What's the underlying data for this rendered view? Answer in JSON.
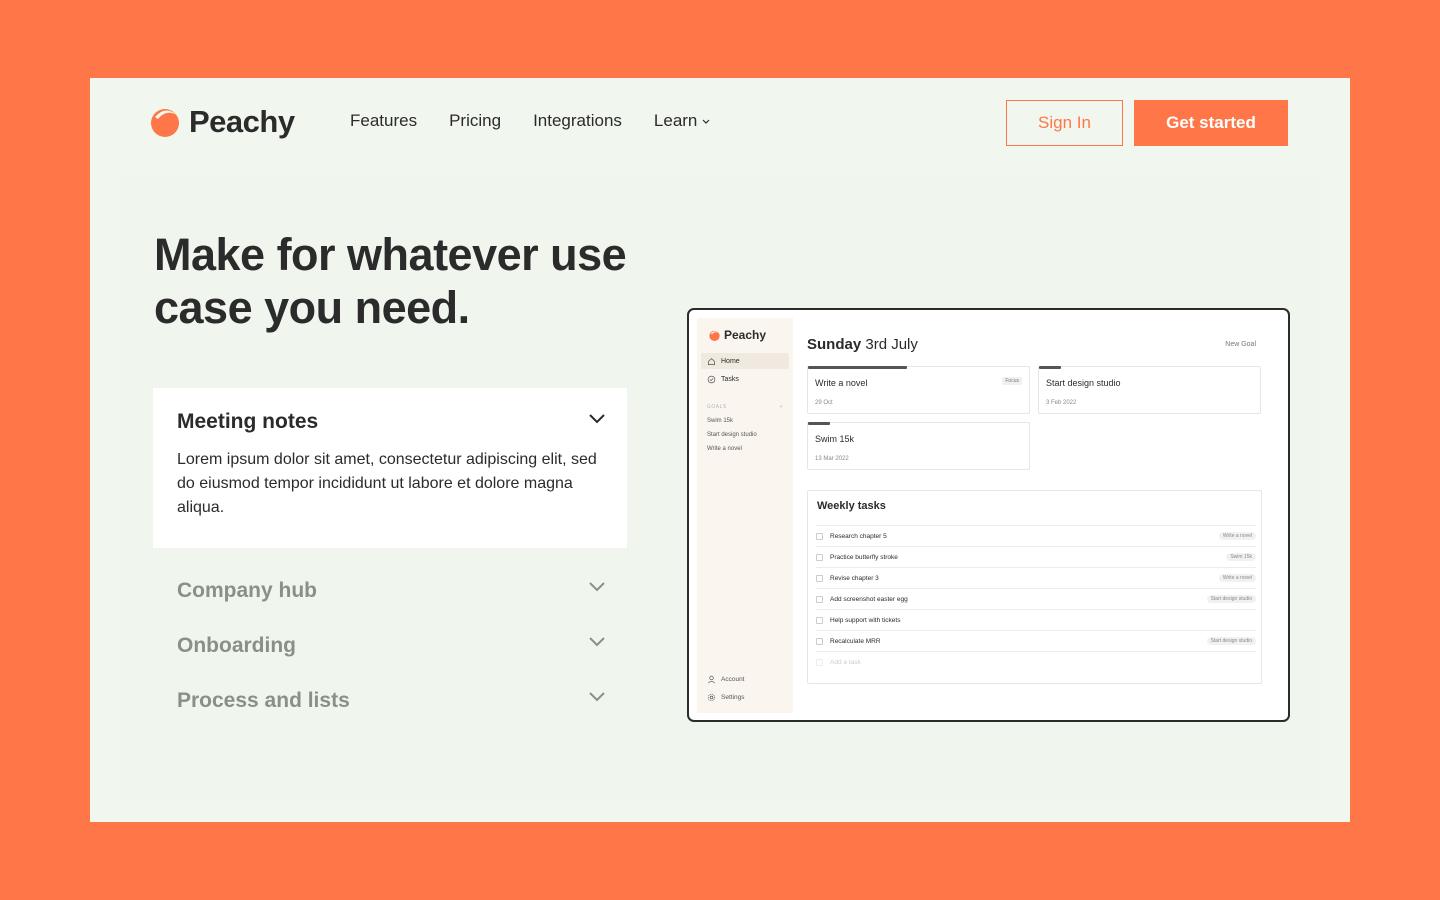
{
  "brand": {
    "name": "Peachy",
    "color": "#ff7748"
  },
  "nav": {
    "items": [
      {
        "label": "Features"
      },
      {
        "label": "Pricing"
      },
      {
        "label": "Integrations"
      },
      {
        "label": "Learn",
        "has_dropdown": true
      }
    ],
    "sign_in": "Sign In",
    "get_started": "Get started"
  },
  "hero": {
    "title": "Make for whatever use case you need."
  },
  "accordion": {
    "open": {
      "title": "Meeting notes",
      "body": "Lorem ipsum dolor sit amet, consectetur adipiscing elit, sed do eiusmod tempor incididunt ut labore et dolore magna aliqua."
    },
    "closed": [
      {
        "title": "Company hub"
      },
      {
        "title": "Onboarding"
      },
      {
        "title": "Process and lists"
      }
    ]
  },
  "app": {
    "brand": "Peachy",
    "sidebar": {
      "nav": [
        {
          "label": "Home",
          "icon": "home-icon",
          "active": true
        },
        {
          "label": "Tasks",
          "icon": "check-circle-icon",
          "active": false
        }
      ],
      "goals_header": "GOALS",
      "goals_add": "+",
      "goals": [
        "Swim 15k",
        "Start design studio",
        "Write a novel"
      ],
      "footer": [
        {
          "label": "Account",
          "icon": "user-icon"
        },
        {
          "label": "Settings",
          "icon": "gear-icon"
        }
      ]
    },
    "header": {
      "day": "Sunday",
      "date": "3rd July",
      "new_goal": "New Goal"
    },
    "goal_cards": [
      {
        "title": "Write a novel",
        "date": "29 Oct",
        "badge": "Focus",
        "progress": 0.45
      },
      {
        "title": "Start design studio",
        "date": "3 Feb 2022",
        "progress": 0.1
      },
      {
        "title": "Swim 15k",
        "date": "13 Mar 2022",
        "progress": 0.1
      }
    ],
    "weekly": {
      "title": "Weekly tasks",
      "tasks": [
        {
          "label": "Research chapter 5",
          "tag": "Write a novel"
        },
        {
          "label": "Practice butterfly stroke",
          "tag": "Swim 15k"
        },
        {
          "label": "Revise chapter 3",
          "tag": "Write a novel"
        },
        {
          "label": "Add screenshot easter egg",
          "tag": "Start design studio"
        },
        {
          "label": "Help support with tickets",
          "tag": ""
        },
        {
          "label": "Recalculate MRR",
          "tag": "Start design studio"
        }
      ],
      "add_placeholder": "Add a task"
    }
  }
}
